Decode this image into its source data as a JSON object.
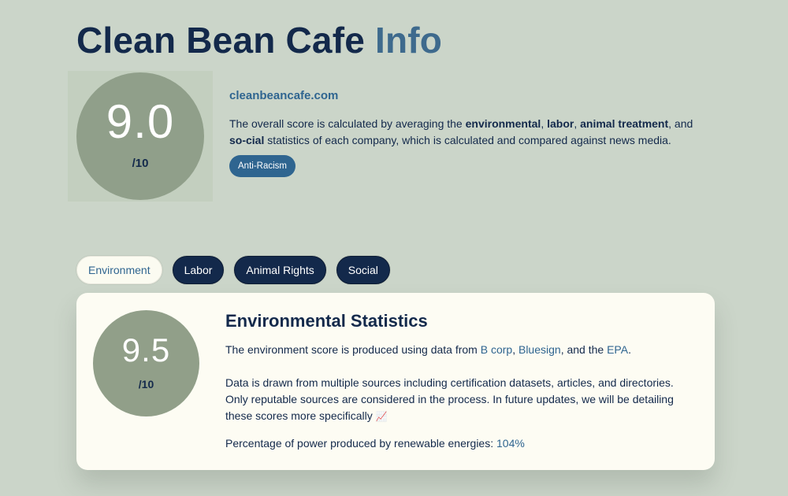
{
  "header": {
    "title_main": "Clean Bean Cafe",
    "title_accent": "Info"
  },
  "overall": {
    "score": "9.0",
    "out_of": "/10",
    "website": "cleanbeancafe.com",
    "description": {
      "p1": "The overall score is calculated by averaging the ",
      "b1": "environmental",
      "s1": ", ",
      "b2": "labor",
      "s2": ", ",
      "b3": "animal treatment",
      "s3": ", and ",
      "b4": "so-cial",
      "p2": " statistics of each company, which is calculated and compared against news media."
    },
    "badge": "Anti-Racism"
  },
  "tabs": [
    {
      "label": "Environment",
      "active": true
    },
    {
      "label": "Labor",
      "active": false
    },
    {
      "label": "Animal Rights",
      "active": false
    },
    {
      "label": "Social",
      "active": false
    }
  ],
  "environment": {
    "score": "9.5",
    "out_of": "/10",
    "title": "Environmental Statistics",
    "sources_prefix": "The environment score is produced using data from ",
    "source_1": "B corp",
    "sep_1": ", ",
    "source_2": "Bluesign",
    "sep_2": ", and the ",
    "source_3": "EPA",
    "sources_suffix": ".",
    "detail": "Data is drawn from multiple sources including certification datasets, articles, and directories. Only reputable sources are considered in the process. In future updates, we will be detailing these scores more specifically",
    "detail_icon": "chart-increasing-icon",
    "renewable_label": "Percentage of power produced by renewable energies: ",
    "renewable_value": "104%"
  }
}
